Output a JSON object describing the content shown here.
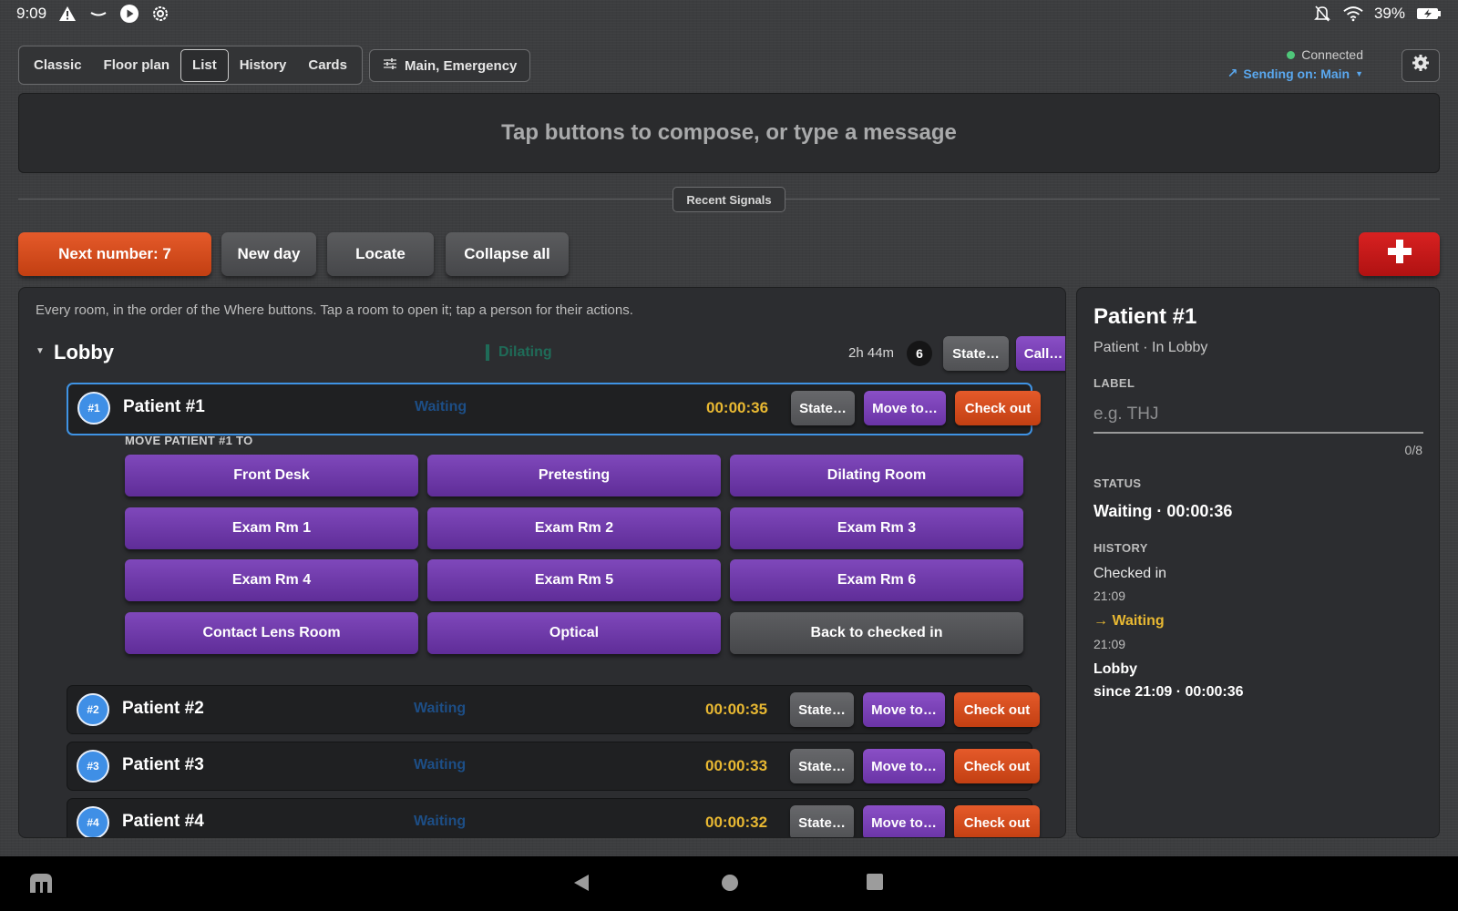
{
  "status_bar": {
    "time": "9:09",
    "battery": "39%"
  },
  "view_tabs": [
    "Classic",
    "Floor plan",
    "List",
    "History",
    "Cards"
  ],
  "active_tab": "List",
  "channels_button": "Main, Emergency",
  "connection": {
    "status": "Connected",
    "sending": "Sending on: Main"
  },
  "compose": {
    "placeholder": "Tap buttons to compose, or type a message"
  },
  "recent_signals": "Recent Signals",
  "actions": {
    "next_number": "Next number: 7",
    "new_day": "New day",
    "locate": "Locate",
    "collapse_all": "Collapse all",
    "add": "+"
  },
  "list": {
    "hint": "Every room, in the order of the Where buttons. Tap a room to open it; tap a person for their actions.",
    "room": {
      "name": "Lobby",
      "state": "Dilating",
      "elapsed": "2h 44m",
      "count": "6",
      "state_button": "State…",
      "call_button": "Call…"
    },
    "row_buttons": {
      "state": "State…",
      "move": "Move to…",
      "checkout": "Check out"
    },
    "patients": [
      {
        "badge": "#1",
        "name": "Patient #1",
        "state": "Waiting",
        "time": "00:00:36"
      },
      {
        "badge": "#2",
        "name": "Patient #2",
        "state": "Waiting",
        "time": "00:00:35"
      },
      {
        "badge": "#3",
        "name": "Patient #3",
        "state": "Waiting",
        "time": "00:00:33"
      },
      {
        "badge": "#4",
        "name": "Patient #4",
        "state": "Waiting",
        "time": "00:00:32"
      }
    ],
    "move_label": "MOVE PATIENT #1 TO",
    "destinations": [
      "Front Desk",
      "Pretesting",
      "Dilating Room",
      "Exam Rm 1",
      "Exam Rm 2",
      "Exam Rm 3",
      "Exam Rm 4",
      "Exam Rm 5",
      "Exam Rm 6",
      "Contact Lens Room",
      "Optical",
      "Back to checked in"
    ]
  },
  "detail": {
    "title": "Patient #1",
    "subtitle": "Patient · In Lobby",
    "label_heading": "LABEL",
    "label_placeholder": "e.g. THJ",
    "label_count": "0/8",
    "status_heading": "STATUS",
    "status_value": "Waiting · 00:00:36",
    "history_heading": "HISTORY",
    "history": {
      "checked_in": "Checked in",
      "checked_in_time": "21:09",
      "waiting": "→ Waiting",
      "waiting_time": "21:09",
      "location": "Lobby",
      "since": "since 21:09 · 00:00:36"
    }
  },
  "colors": {
    "accent_orange": "#d44a1c",
    "accent_purple": "#7440b0",
    "accent_red": "#c41818",
    "selected_border": "#3f93e4",
    "timer_yellow": "#e8b832",
    "connected_green": "#4fc77a"
  }
}
